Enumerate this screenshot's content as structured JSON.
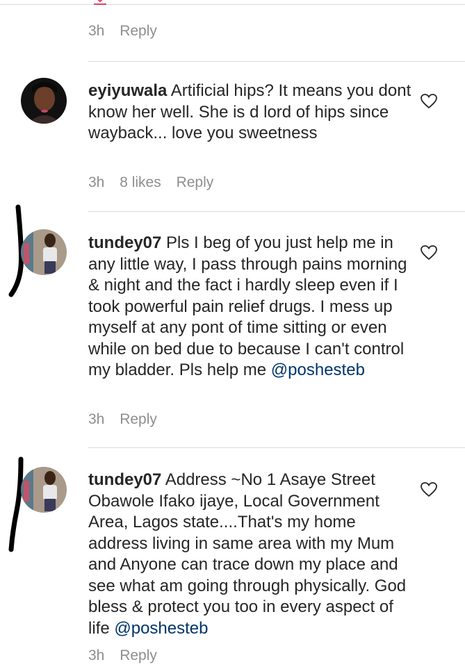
{
  "top_comment": {
    "time": "3h",
    "reply": "Reply"
  },
  "comments": [
    {
      "username": "eyiyuwala",
      "text": "Artificial hips? It means you dont know her well. She is d lord of hips since wayback... love you sweetness",
      "time": "3h",
      "likes": "8 likes",
      "reply": "Reply"
    },
    {
      "username": "tundey07",
      "text": "Pls I beg of you just help me in any little way, I pass through pains morning & night and the fact i hardly sleep even if I took powerful pain relief drugs. I mess up myself at any pont of time sitting or even while on bed due to because I can't control my bladder. Pls help me",
      "mention": "@poshesteb",
      "time": "3h",
      "reply": "Reply"
    },
    {
      "username": "tundey07",
      "text": "Address ~No 1 Asaye Street Obawole Ifako ijaye, Local Government Area, Lagos state....That's my home address living in same area with my Mum and Anyone can trace down my place and see what am going through physically. God bless & protect you too in every aspect of life",
      "mention": "@poshesteb",
      "time": "3h",
      "reply": "Reply"
    }
  ],
  "icons": {
    "like": "heart-icon",
    "top": "partial-heart-icon"
  },
  "colors": {
    "text": "#262626",
    "meta": "#8e8e8e",
    "mention": "#003569",
    "divider": "#dbdbdb",
    "marker": "#000000"
  }
}
